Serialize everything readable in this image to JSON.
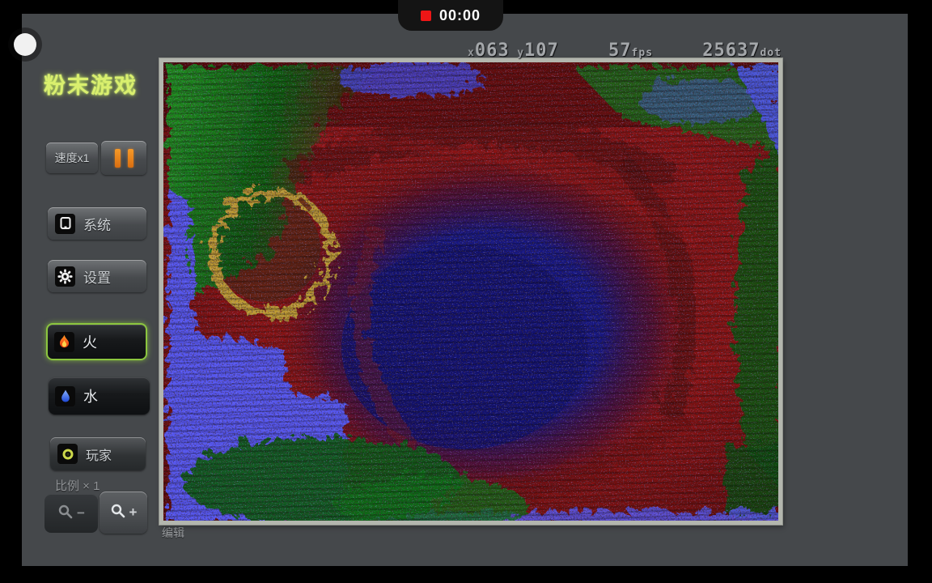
{
  "screen": {
    "recording_time": "00:00"
  },
  "app": {
    "title": "粉末游戏",
    "status_bar": {
      "x_prefix": "x",
      "x_value": "063",
      "y_prefix": "y",
      "y_value": "107",
      "fps_value": "57",
      "fps_unit": "fps",
      "dot_value": "25637",
      "dot_unit": "dot"
    },
    "sidebar": {
      "speed_button_label": "速度x1",
      "menu_buttons": [
        {
          "id": "system",
          "label": "系统"
        },
        {
          "id": "settings",
          "label": "设置"
        }
      ],
      "element_buttons": [
        {
          "id": "fire",
          "label": "火",
          "selected": true
        },
        {
          "id": "water",
          "label": "水",
          "selected": false
        }
      ],
      "player_button_label": "玩家",
      "scale_label": "比例 × 1",
      "zoom_out_sign": "−",
      "zoom_in_sign": "+"
    },
    "edit_label": "编辑",
    "colors": {
      "app_background": "#45484b",
      "title_green": "#d9ef6e",
      "selected_border_green": "#8cc63f",
      "pause_orange": "#e8821e",
      "status_text_gray": "#a4a7aa",
      "sim_red": "#7c0f0f",
      "sim_navy_center": "#15157e",
      "sim_bright_blue": "#5457ee",
      "sim_green": "#157015",
      "gold_ring": "#bf9c30"
    }
  }
}
